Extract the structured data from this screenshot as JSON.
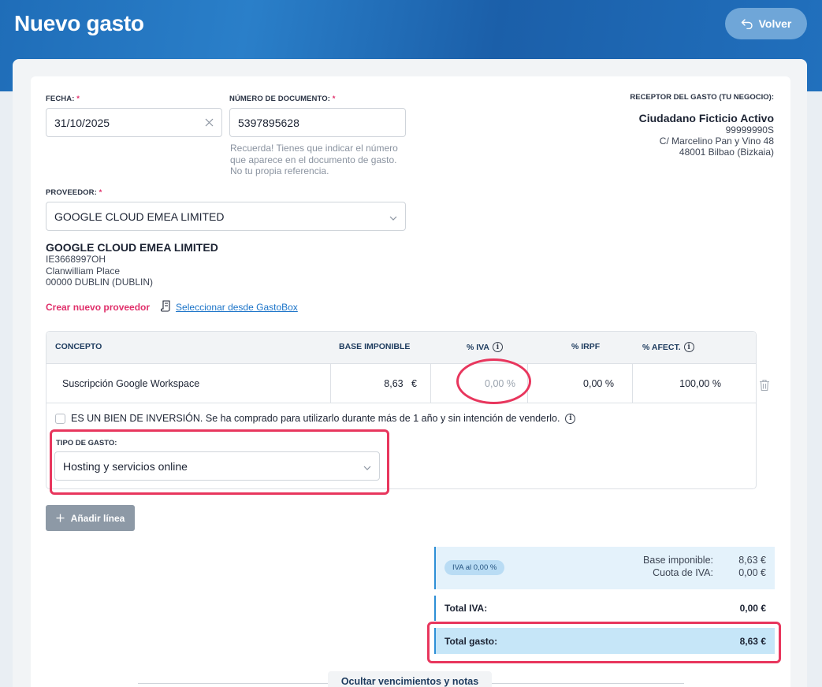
{
  "header": {
    "title": "Nuevo gasto",
    "back_label": "Volver"
  },
  "form": {
    "fecha": {
      "label": "FECHA:",
      "required": "*",
      "value": "31/10/2025",
      "clear_icon": "close-icon"
    },
    "numero_documento": {
      "label": "NÚMERO DE DOCUMENTO:",
      "required": "*",
      "value": "5397895628",
      "hint": [
        "Recuerda! Tienes que indicar el número",
        "que aparece en el documento de gasto.",
        "No tu propia referencia."
      ]
    },
    "proveedor": {
      "label": "PROVEEDOR:",
      "required": "*",
      "value": "GOOGLE CLOUD EMEA LIMITED"
    }
  },
  "receptor": {
    "label": "RECEPTOR DEL GASTO (TU NEGOCIO):",
    "name": "Ciudadano Ficticio Activo",
    "lines": [
      "99999990S",
      "C/ Marcelino Pan y Vino 48",
      "48001 Bilbao (Bizkaia)"
    ]
  },
  "provider_details": {
    "name": "GOOGLE CLOUD EMEA LIMITED",
    "lines": [
      "IE3668997OH",
      "Clanwilliam Place",
      "00000 DUBLIN (DUBLIN)"
    ]
  },
  "links": {
    "create_provider": "Crear nuevo proveedor",
    "select_gastobox": "Seleccionar desde GastoBox"
  },
  "table": {
    "headers": {
      "concepto": "CONCEPTO",
      "base": "BASE IMPONIBLE",
      "iva": "% IVA",
      "irpf": "% IRPF",
      "afect": "% AFECT."
    },
    "row": {
      "concepto": "Suscripción Google Workspace",
      "base": "8,63",
      "base_unit": "€",
      "iva": "0,00",
      "irpf": "0,00",
      "afect": "100,00",
      "pct": "%"
    },
    "inversion_text": "ES UN BIEN DE INVERSIÓN. Se ha comprado para utilizarlo durante más de 1 año y sin intención de venderlo.",
    "tipo_label": "TIPO DE GASTO:",
    "tipo_value": "Hosting y servicios online"
  },
  "add_line_label": "Añadir línea",
  "summary": {
    "iva_badge": "IVA al 0,00 %",
    "base_label": "Base imponible:",
    "base_value": "8,63 €",
    "cuota_label": "Cuota de IVA:",
    "cuota_value": "0,00 €",
    "total_iva_label": "Total IVA:",
    "total_iva_value": "0,00 €",
    "total_gasto_label": "Total gasto:",
    "total_gasto_value": "8,63 €"
  },
  "notes_toggle": "Ocultar vencimientos y notas",
  "colors": {
    "header_blue": "#1f6db8",
    "accent_pink": "#e0306b",
    "highlight_red": "#e8365d",
    "link_blue": "#1a73c8"
  }
}
